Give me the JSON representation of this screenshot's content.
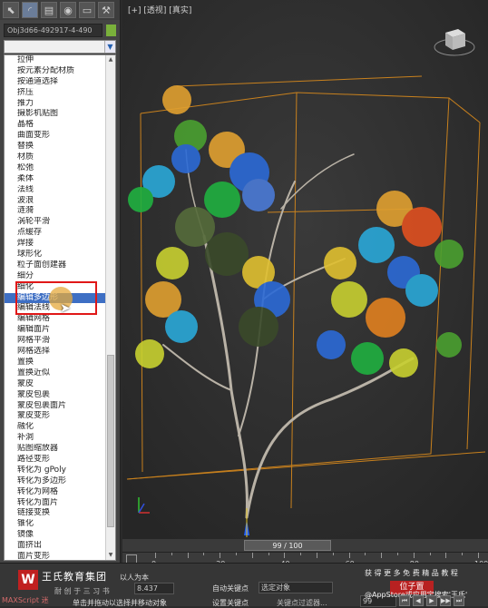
{
  "toolbar": {
    "icons": [
      "select-object-icon",
      "modify-curve-icon",
      "hierarchy-icon",
      "motion-icon",
      "display-icon",
      "utilities-hammer-icon"
    ]
  },
  "object": {
    "name": "Obj3d66-492917-4-490",
    "color": "#7ab13b"
  },
  "modifier_dropdown": {
    "value": "",
    "arrow": "▼"
  },
  "modifier_list": [
    "拉伸",
    "按元素分配材质",
    "按通道选择",
    "挤压",
    "推力",
    "摄影机贴图",
    "晶格",
    "曲面变形",
    "替换",
    "材质",
    "松弛",
    "柔体",
    "法线",
    "波浪",
    "涟漪",
    "涡轮平滑",
    "点缓存",
    "焊接",
    "球形化",
    "粒子面创建器",
    "细分",
    "细化",
    "编辑多边形",
    "编辑法线",
    "编辑网格",
    "编辑面片",
    "网格平滑",
    "网格选择",
    "置换",
    "置换近似",
    "蒙皮",
    "蒙皮包裹",
    "蒙皮包裹面片",
    "蒙皮变形",
    "融化",
    "补洞",
    "贴图缩放器",
    "路径变形",
    "转化为 gPoly",
    "转化为多边形",
    "转化为网格",
    "转化为面片",
    "链接变换",
    "锥化",
    "镜像",
    "面挤出",
    "面片变形"
  ],
  "selected_index": 22,
  "viewport": {
    "label": "[+] [透视] [真实]"
  },
  "timeline": {
    "frame_counter": "99 / 100",
    "ruler_numbers": [
      "0",
      "20",
      "40",
      "60",
      "80",
      "100"
    ]
  },
  "bottom": {
    "logo_letter": "W",
    "brand": "王氏教育集团",
    "brand_sub": "以人为本",
    "prompt_line": "耐 创 于 三 习 书",
    "coord_value": "8.437",
    "auto_key": "自动关键点",
    "set_key": "设置关键点",
    "key_filter_select": "选定对象",
    "key_filter_btn": "关键点过滤器...",
    "red_button": "位子置",
    "frame_field": "99",
    "status_text": "单击并拖动以选择并移动对象",
    "maxscript": "MAXScript 迷",
    "watermark_top": "获 得 更 多 免 费 精 品 教 程",
    "watermark_bottom": "@AppStore或应用宝搜索'王氏'",
    "playback": [
      "⏮",
      "◀",
      "▶",
      "▶▶",
      "⏭"
    ]
  }
}
